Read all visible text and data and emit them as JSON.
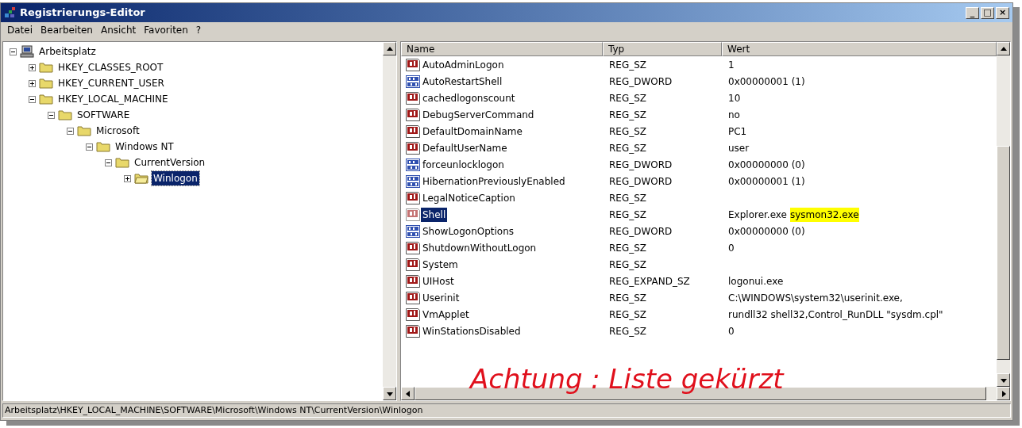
{
  "window": {
    "title": "Registrierungs-Editor",
    "controls": [
      "_",
      "□",
      "×"
    ]
  },
  "menu": [
    {
      "label": "Datei"
    },
    {
      "label": "Bearbeiten"
    },
    {
      "label": "Ansicht"
    },
    {
      "label": "Favoriten"
    },
    {
      "label": "?"
    }
  ],
  "tree": [
    {
      "label": "Arbeitsplatz",
      "kind": "computer",
      "expanded": true,
      "selected": false,
      "children": [
        {
          "label": "HKEY_CLASSES_ROOT",
          "kind": "folder",
          "expanded": false,
          "selected": false
        },
        {
          "label": "HKEY_CURRENT_USER",
          "kind": "folder",
          "expanded": false,
          "selected": false
        },
        {
          "label": "HKEY_LOCAL_MACHINE",
          "kind": "folder",
          "expanded": true,
          "selected": false,
          "children": [
            {
              "label": "SOFTWARE",
              "kind": "folder",
              "expanded": true,
              "selected": false,
              "children": [
                {
                  "label": "Microsoft",
                  "kind": "folder",
                  "expanded": true,
                  "selected": false,
                  "children": [
                    {
                      "label": "Windows NT",
                      "kind": "folder",
                      "expanded": true,
                      "selected": false,
                      "children": [
                        {
                          "label": "CurrentVersion",
                          "kind": "folder",
                          "expanded": true,
                          "selected": false,
                          "children": [
                            {
                              "label": "Winlogon",
                              "kind": "folder",
                              "expanded": false,
                              "selected": true
                            }
                          ]
                        }
                      ]
                    }
                  ]
                }
              ]
            }
          ]
        }
      ]
    }
  ],
  "table": {
    "columns": [
      "Name",
      "Typ",
      "Wert"
    ],
    "rows": [
      {
        "kind": "string",
        "name": "AutoAdminLogon",
        "type": "REG_SZ",
        "value": "1",
        "selected": false
      },
      {
        "kind": "binary",
        "name": "AutoRestartShell",
        "type": "REG_DWORD",
        "value": "0x00000001 (1)",
        "selected": false
      },
      {
        "kind": "string",
        "name": "cachedlogonscount",
        "type": "REG_SZ",
        "value": "10",
        "selected": false
      },
      {
        "kind": "string",
        "name": "DebugServerCommand",
        "type": "REG_SZ",
        "value": "no",
        "selected": false
      },
      {
        "kind": "string",
        "name": "DefaultDomainName",
        "type": "REG_SZ",
        "value": "PC1",
        "selected": false
      },
      {
        "kind": "string",
        "name": "DefaultUserName",
        "type": "REG_SZ",
        "value": "user",
        "selected": false
      },
      {
        "kind": "binary",
        "name": "forceunlocklogon",
        "type": "REG_DWORD",
        "value": "0x00000000 (0)",
        "selected": false
      },
      {
        "kind": "binary",
        "name": "HibernationPreviouslyEnabled",
        "type": "REG_DWORD",
        "value": "0x00000001 (1)",
        "selected": false
      },
      {
        "kind": "string",
        "name": "LegalNoticeCaption",
        "type": "REG_SZ",
        "selected": false
      },
      {
        "kind": "string",
        "name": "Shell",
        "type": "REG_SZ",
        "value": "Explorer.exe",
        "highlighted_value": "sysmon32.exe",
        "selected": true
      },
      {
        "kind": "binary",
        "name": "ShowLogonOptions",
        "type": "REG_DWORD",
        "value": "0x00000000 (0)",
        "selected": false
      },
      {
        "kind": "string",
        "name": "ShutdownWithoutLogon",
        "type": "REG_SZ",
        "value": "0",
        "selected": false
      },
      {
        "kind": "string",
        "name": "System",
        "type": "REG_SZ",
        "selected": false
      },
      {
        "kind": "string",
        "name": "UIHost",
        "type": "REG_EXPAND_SZ",
        "value": "logonui.exe",
        "selected": false
      },
      {
        "kind": "string",
        "name": "Userinit",
        "type": "REG_SZ",
        "value": "C:\\WINDOWS\\system32\\userinit.exe,",
        "selected": false
      },
      {
        "kind": "string",
        "name": "VmApplet",
        "type": "REG_SZ",
        "value": "rundll32 shell32,Control_RunDLL \"sysdm.cpl\"",
        "selected": false
      },
      {
        "kind": "string",
        "name": "WinStationsDisabled",
        "type": "REG_SZ",
        "value": "0",
        "selected": false
      }
    ]
  },
  "annotation": "Achtung : Liste gekürzt",
  "status_bar": "Arbeitsplatz\\HKEY_LOCAL_MACHINE\\SOFTWARE\\Microsoft\\Windows NT\\CurrentVersion\\Winlogon"
}
